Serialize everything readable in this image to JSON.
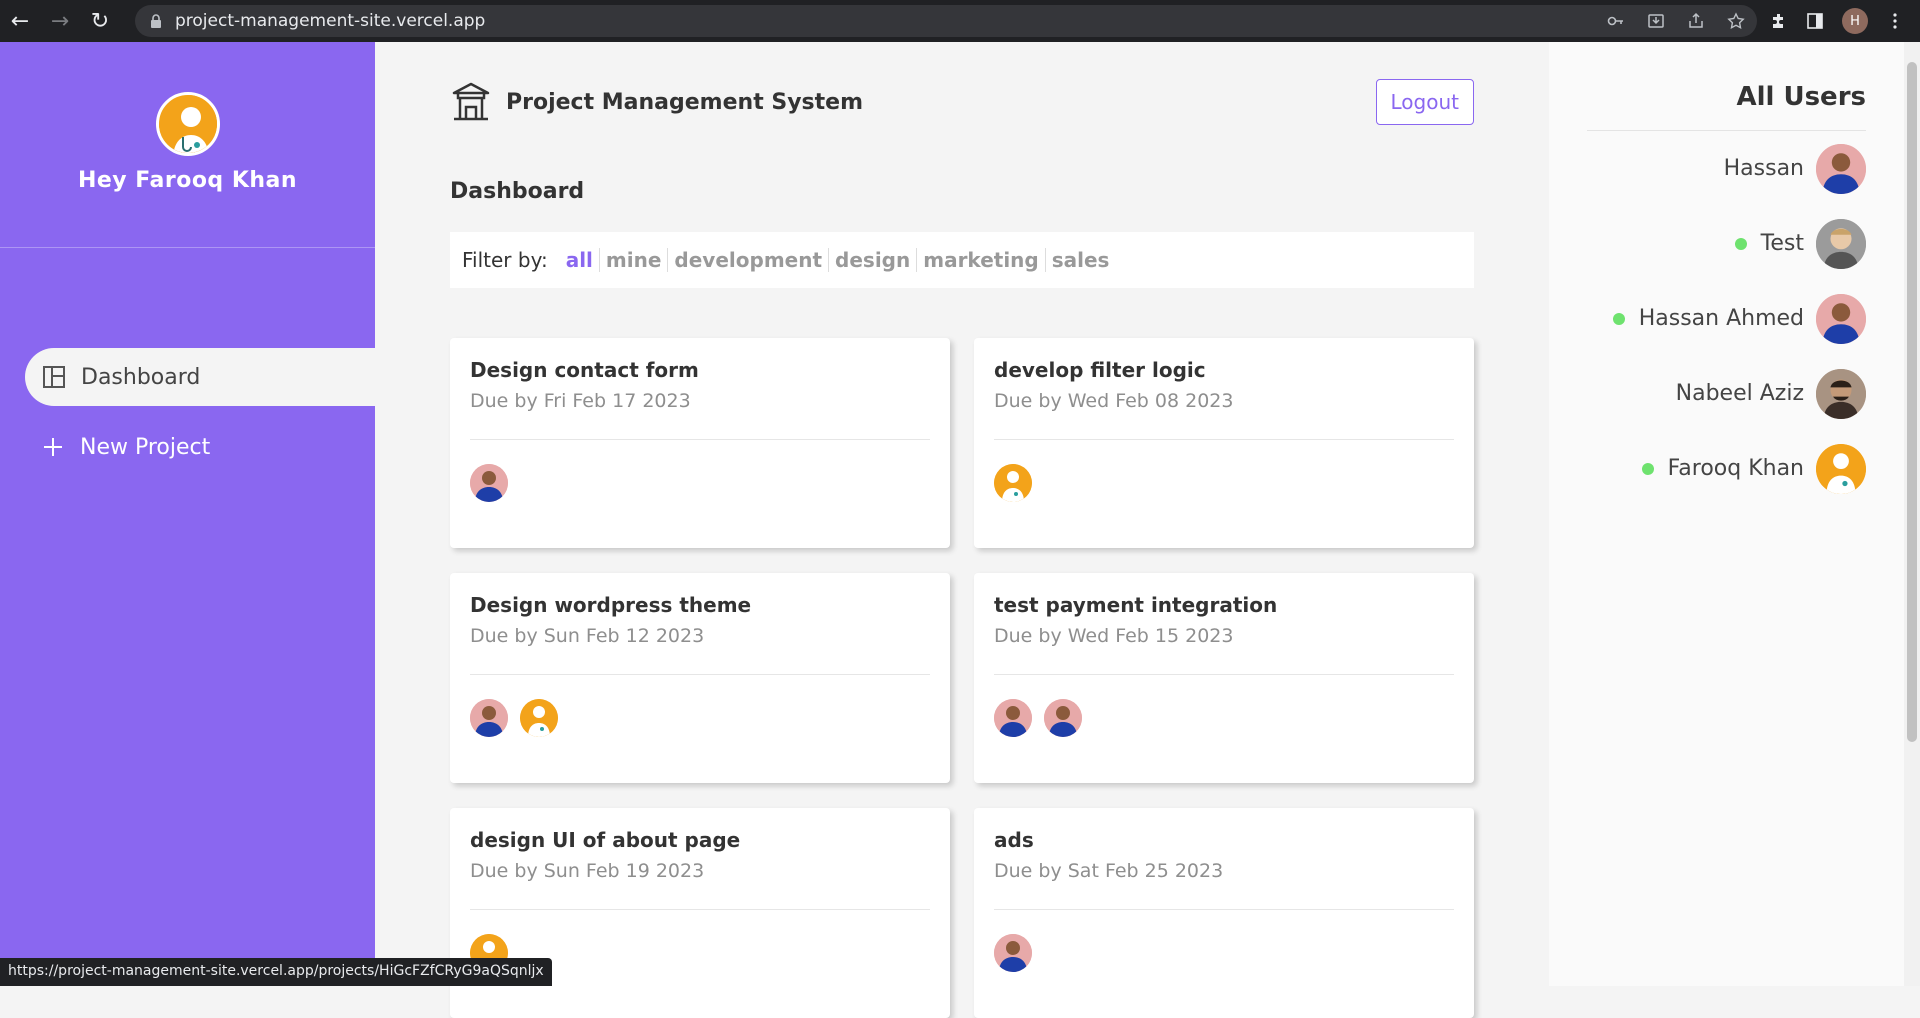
{
  "browser": {
    "url": "project-management-site.vercel.app",
    "profile_initial": "H",
    "status_url": "https://project-management-site.vercel.app/projects/HiGcFZfCRyG9aQSqnljx"
  },
  "sidebar": {
    "greeting": "Hey Farooq Khan",
    "items": [
      {
        "label": "Dashboard",
        "icon": "dashboard-icon",
        "active": true
      },
      {
        "label": "New Project",
        "icon": "plus-icon",
        "active": false
      }
    ]
  },
  "header": {
    "title": "Project Management System",
    "logout_label": "Logout"
  },
  "page_title": "Dashboard",
  "filter": {
    "label": "Filter by:",
    "options": [
      "all",
      "mine",
      "development",
      "design",
      "marketing",
      "sales"
    ],
    "active": "all"
  },
  "projects": [
    {
      "title": "Design contact form",
      "due": "Due by Fri Feb 17 2023",
      "assignees": [
        "hassan"
      ]
    },
    {
      "title": "develop filter logic",
      "due": "Due by Wed Feb 08 2023",
      "assignees": [
        "farooq"
      ]
    },
    {
      "title": "Design wordpress theme",
      "due": "Due by Sun Feb 12 2023",
      "assignees": [
        "hassan",
        "farooq"
      ]
    },
    {
      "title": "test payment integration",
      "due": "Due by Wed Feb 15 2023",
      "assignees": [
        "hassan",
        "hassan"
      ]
    },
    {
      "title": "design UI of about page",
      "due": "Due by Sun Feb 19 2023",
      "assignees": [
        "farooq"
      ]
    },
    {
      "title": "ads",
      "due": "Due by Sat Feb 25 2023",
      "assignees": [
        "hassan"
      ]
    }
  ],
  "users_panel": {
    "title": "All Users",
    "users": [
      {
        "name": "Hassan",
        "online": false
      },
      {
        "name": "Test",
        "online": true
      },
      {
        "name": "Hassan Ahmed",
        "online": true
      },
      {
        "name": "Nabeel Aziz",
        "online": false
      },
      {
        "name": "Farooq Khan",
        "online": true
      }
    ]
  },
  "colors": {
    "accent": "#8a67f0",
    "online": "#6ee26e",
    "sidebar_bg": "#8a67f0"
  }
}
